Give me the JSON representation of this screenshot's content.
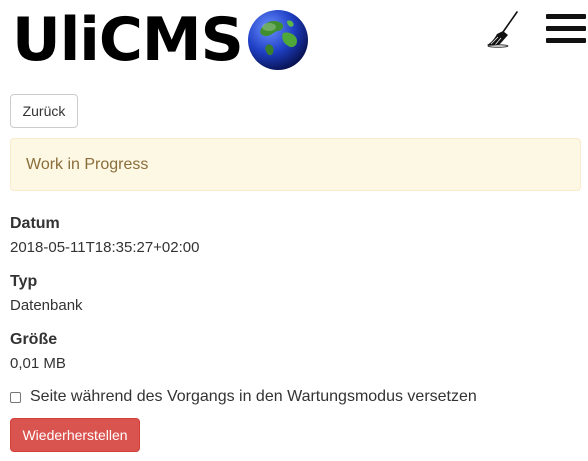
{
  "header": {
    "logo_text": "UliCMS",
    "logo_icon": "globe-icon",
    "broom_icon": "broom-icon",
    "menu_icon": "hamburger-menu-icon"
  },
  "back_button": {
    "label": "Zurück"
  },
  "alert": {
    "text": "Work in Progress",
    "background": "#fcf8e3",
    "color": "#8a6d3b"
  },
  "details": [
    {
      "label": "Datum",
      "value": "2018-05-11T18:35:27+02:00"
    },
    {
      "label": "Typ",
      "value": "Datenbank"
    },
    {
      "label": "Größe",
      "value": "0,01 MB"
    }
  ],
  "maintenance_checkbox": {
    "label": "Seite während des Vorgangs in den Wartungsmodus versetzen",
    "checked": false
  },
  "restore_button": {
    "label": "Wiederherstellen",
    "color": "#d9534f"
  }
}
